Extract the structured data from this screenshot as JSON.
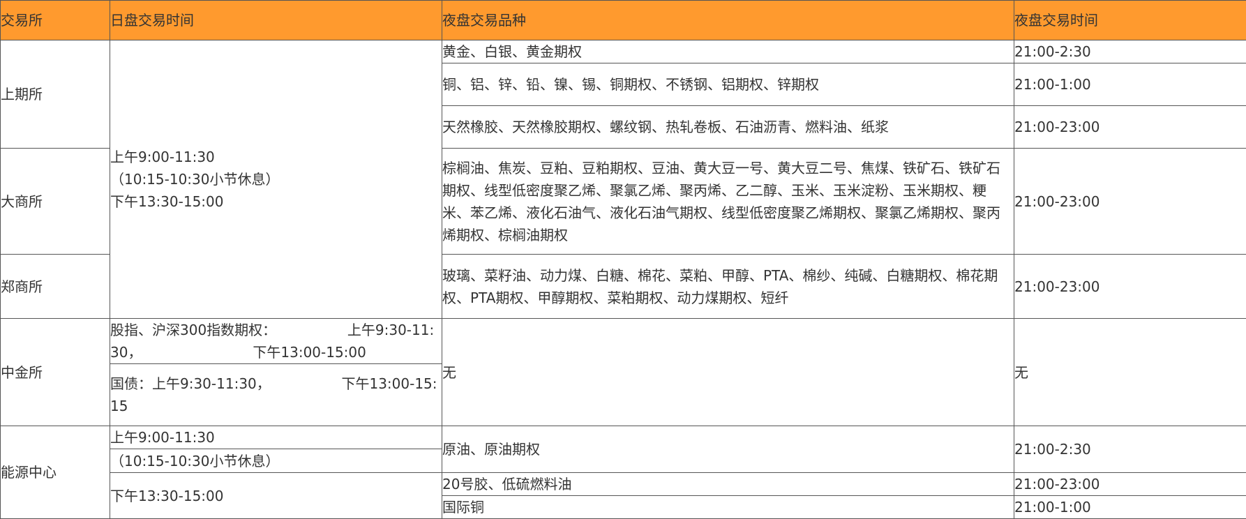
{
  "table": {
    "headers": [
      "交易所",
      "日盘交易时间",
      "夜盘交易品种",
      "夜盘交易时间"
    ],
    "shfe": {
      "exchange": "上期所",
      "rows": [
        {
          "products": "黄金、白银、黄金期权",
          "time": "21:00-2:30"
        },
        {
          "products": "铜、铝、锌、铅、镍、锡、铜期权、不锈钢、铝期权、锌期权",
          "time": "21:00-1:00"
        },
        {
          "products": "天然橡胶、天然橡胶期权、螺纹钢、热轧卷板、石油沥青、燃料油、纸浆",
          "time": "21:00-23:00"
        }
      ]
    },
    "shared_day_session": {
      "line1": "上午9:00-11:30",
      "line2": "（10:15-10:30小节休息）",
      "line3": "下午13:30-15:00"
    },
    "dce": {
      "exchange": "大商所",
      "products": "棕榈油、焦炭、豆粕、豆粕期权、豆油、黄大豆一号、黄大豆二号、焦煤、铁矿石、铁矿石期权、线型低密度聚乙烯、聚氯乙烯、聚丙烯、乙二醇、玉米、玉米淀粉、玉米期权、粳米、苯乙烯、液化石油气、液化石油气期权、线型低密度聚乙烯期权、聚氯乙烯期权、聚丙烯期权、棕榈油期权",
      "time": "21:00-23:00"
    },
    "czce": {
      "exchange": "郑商所",
      "products": "玻璃、菜籽油、动力煤、白糖、棉花、菜粕、甲醇、PTA、棉纱、纯碱、白糖期权、棉花期权、PTA期权、甲醇期权、菜粕期权、动力煤期权、短纤",
      "time": "21:00-23:00"
    },
    "cffex": {
      "exchange": "中金所",
      "day_index": "股指、沪深300指数期权：                上午9:30-11:30，                         下午13:00-15:00",
      "day_bond": "国债：上午9:30-11:30，                下午13:00-15:15",
      "products": "无",
      "time": "无"
    },
    "ine": {
      "exchange": "能源中心",
      "day_line1": "上午9:00-11:30",
      "day_line2": "（10:15-10:30小节休息）",
      "day_line3": "下午13:30-15:00",
      "rows": [
        {
          "products": "原油、原油期权",
          "time": "21:00-2:30"
        },
        {
          "products": "20号胶、低硫燃料油",
          "time": "21:00-23:00"
        },
        {
          "products": "国际铜",
          "time": "21:00-1:00"
        }
      ]
    }
  }
}
